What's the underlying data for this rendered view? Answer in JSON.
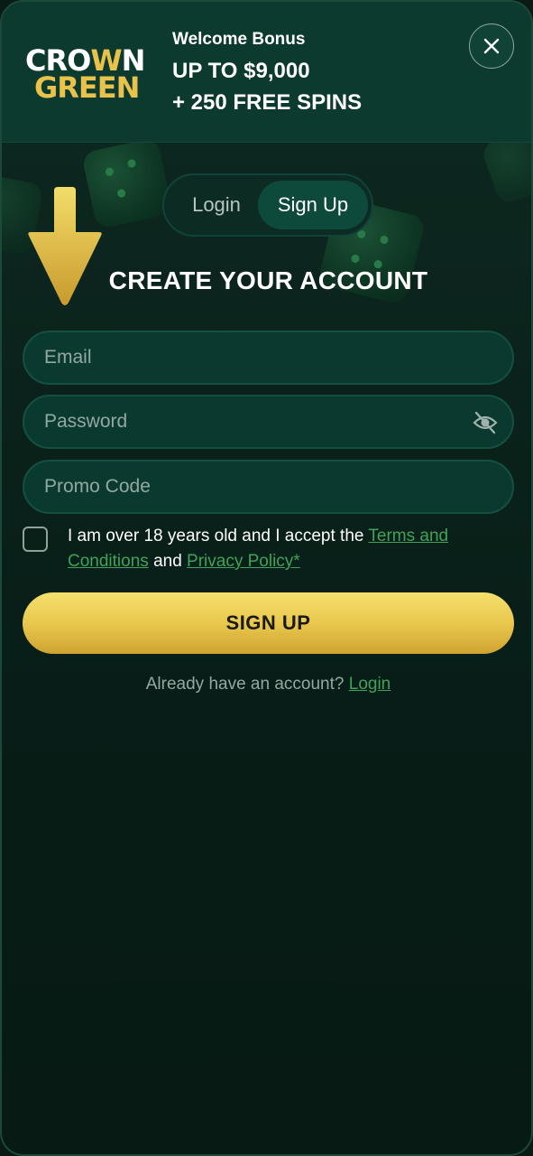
{
  "header": {
    "logo_line1": "CRO",
    "logo_w": "W",
    "logo_n": "N",
    "logo_line2": "GREEN",
    "bonus_label": "Welcome Bonus",
    "bonus_line1": "UP TO $9,000",
    "bonus_line2": "+ 250 FREE SPINS",
    "close_icon": "close-icon"
  },
  "tabs": {
    "login": "Login",
    "signup": "Sign Up",
    "active": "signup"
  },
  "form": {
    "title": "CREATE YOUR ACCOUNT",
    "email_placeholder": "Email",
    "password_placeholder": "Password",
    "promo_placeholder": "Promo Code",
    "password_icon": "eye-slash-icon",
    "terms_prefix": "I am over 18 years old and I accept the",
    "terms_link": "Terms and Conditions",
    "terms_and": "and",
    "privacy_link": "Privacy Policy*",
    "submit_label": "SIGN UP",
    "already_text": "Already have an account?",
    "login_link": "Login"
  },
  "colors": {
    "accent_gold": "#e9c84d",
    "link_green": "#3fa35a",
    "panel_green": "#0d3a2e"
  }
}
